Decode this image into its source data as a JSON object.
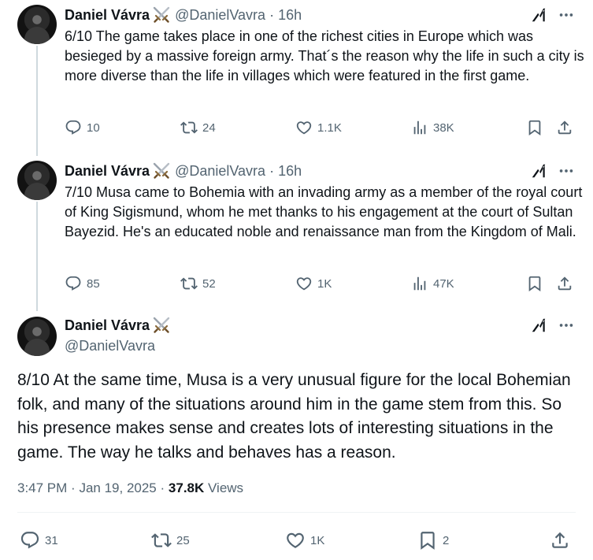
{
  "author": {
    "name": "Daniel Vávra",
    "handle": "@DanielVavra",
    "badge_icon": "crossed-swords-icon",
    "verified_icon": "grok-icon"
  },
  "tweets": [
    {
      "time": "16h",
      "text": "6/10 The game takes place in one of the richest cities in Europe which was besieged by a massive foreign army. That´s the reason why the life in such a city is more diverse than the life in villages which were featured in the first game.",
      "replies": "10",
      "reposts": "24",
      "likes": "1.1K",
      "views": "38K"
    },
    {
      "time": "16h",
      "text": "7/10 Musa came to Bohemia with an invading army as a member of the royal court of King Sigismund, whom he met thanks to his engagement at the court of Sultan Bayezid. He's an educated noble and renaissance man from the Kingdom of Mali.",
      "replies": "85",
      "reposts": "52",
      "likes": "1K",
      "views": "47K"
    }
  ],
  "main_tweet": {
    "text": "8/10 At the same time, Musa is a very unusual figure for the local Bohemian folk, and many of the situations around him in the game stem from this. So his presence makes sense and creates lots of interesting situations in the game. The way he talks and behaves has a reason.",
    "time": "3:47 PM",
    "date": "Jan 19, 2025",
    "separator": "·",
    "views_count": "37.8K",
    "views_label": "Views",
    "replies": "31",
    "reposts": "25",
    "likes": "1K",
    "bookmarks": "2"
  },
  "dot": "·"
}
